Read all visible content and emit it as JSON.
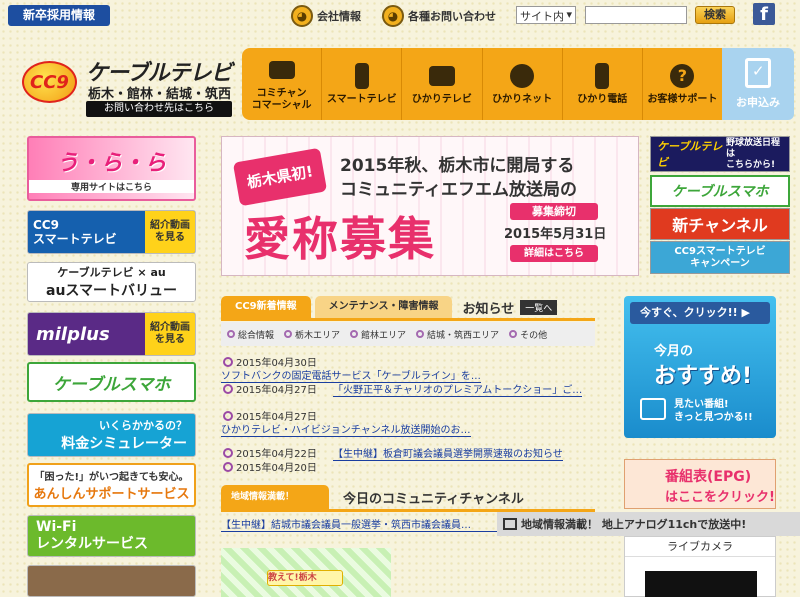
{
  "topbar": {
    "recruit": "新卒採用情報",
    "company": "会社情報",
    "contact": "各種お問い合わせ",
    "site_select": "サイト内",
    "search_placeholder": "",
    "search_button": "検索",
    "facebook": "f"
  },
  "logo": {
    "mark": "CC9",
    "name": "ケーブルテレビ",
    "areas": "栃木・館林・結城・筑西",
    "inquiry": "お問い合わせ先はこちら"
  },
  "nav": [
    {
      "label": "コミチャン\nコマーシャル",
      "icon": "camera-icon"
    },
    {
      "label": "スマートテレビ",
      "icon": "remote-icon"
    },
    {
      "label": "ひかりテレビ",
      "icon": "tv-icon"
    },
    {
      "label": "ひかりネット",
      "icon": "globe-icon"
    },
    {
      "label": "ひかり電話",
      "icon": "phone-icon"
    },
    {
      "label": "お客様サポート",
      "icon": "help-icon"
    }
  ],
  "apply": "お申込み",
  "left_banners": {
    "b0_big": "う・ら・ら",
    "b0_small": "専用サイトはこちら",
    "b1_main": "CC9\nスマートテレビ",
    "b1_sub": "紹介動画\nを見る",
    "b2_top": "ケーブルテレビ × au",
    "b2_main": "auスマートバリュー",
    "b3_main": "milplus",
    "b3_sub": "紹介動画\nを見る",
    "b4_main": "ケーブルスマホ",
    "b5_top": "いくらかかるの？",
    "b5_main": "料金シミュレーター",
    "b6_top": "「困った!」がいつ起きても安心。",
    "b6_main": "あんしんサポートサービス",
    "b7_main": "Wi-Fi\nレンタルサービス"
  },
  "banner": {
    "badge": "栃木県初!",
    "line1": "2015年秋、栃木市に開局する",
    "line2": "コミュニティエフエム放送局の",
    "big": "愛称募集",
    "closed": "募集締切",
    "date": "2015年5月31日",
    "detail": "詳細はこちら"
  },
  "right_banners": {
    "r0_logo": "ケーブルテレビ",
    "r0_text": "野球放送日程は\nこちらから!",
    "r1": "ケーブルスマホ",
    "r2": "新チャンネル",
    "r3_l1": "CC9スマートテレビ",
    "r3_l2": "キャンペーン"
  },
  "news": {
    "tab1": "CC9新着情報",
    "tab2": "メンテナンス・障害情報",
    "heading": "お知らせ",
    "all_button": "一覧へ",
    "filters": [
      "総合情報",
      "栃木エリア",
      "館林エリア",
      "結城・筑西エリア",
      "その他"
    ],
    "items": [
      {
        "date": "2015年04月30日",
        "title": "ソフトバンクの固定電話サービス「ケーブルライン」を…"
      },
      {
        "date": "2015年04月27日",
        "title": "「火野正平＆チャリオのプレミアムトークショー」ご…"
      },
      {
        "date": "2015年04月27日",
        "title": "ひかりテレビ・ハイビジョンチャンネル放送開始のお…"
      },
      {
        "date": "2015年04月22日",
        "title": "【生中継】板倉町議会議員選挙開票速報のお知らせ"
      },
      {
        "date": "2015年04月20日",
        "title": ""
      }
    ]
  },
  "community": {
    "tag": "地域情報満載！",
    "heading": "今日のコミュニティチャンネル",
    "program": "【生中継】結城市議会議員一般選挙・筑西市議会議員…",
    "ticker": "地域情報満載！ 地上アナログ11chで放送中!",
    "image_label": "教えて!栃木"
  },
  "right_lower": {
    "osusume_head": "今すぐ、クリック!! ▶",
    "osusume_t1": "今月の",
    "osusume_t2": "おすすめ!",
    "osusume_t3": "見たい番組!\nきっと見つかる!!",
    "epg_t1": "番組表(EPG)",
    "epg_t2": "はここをクリック!",
    "live": "ライブカメラ"
  }
}
